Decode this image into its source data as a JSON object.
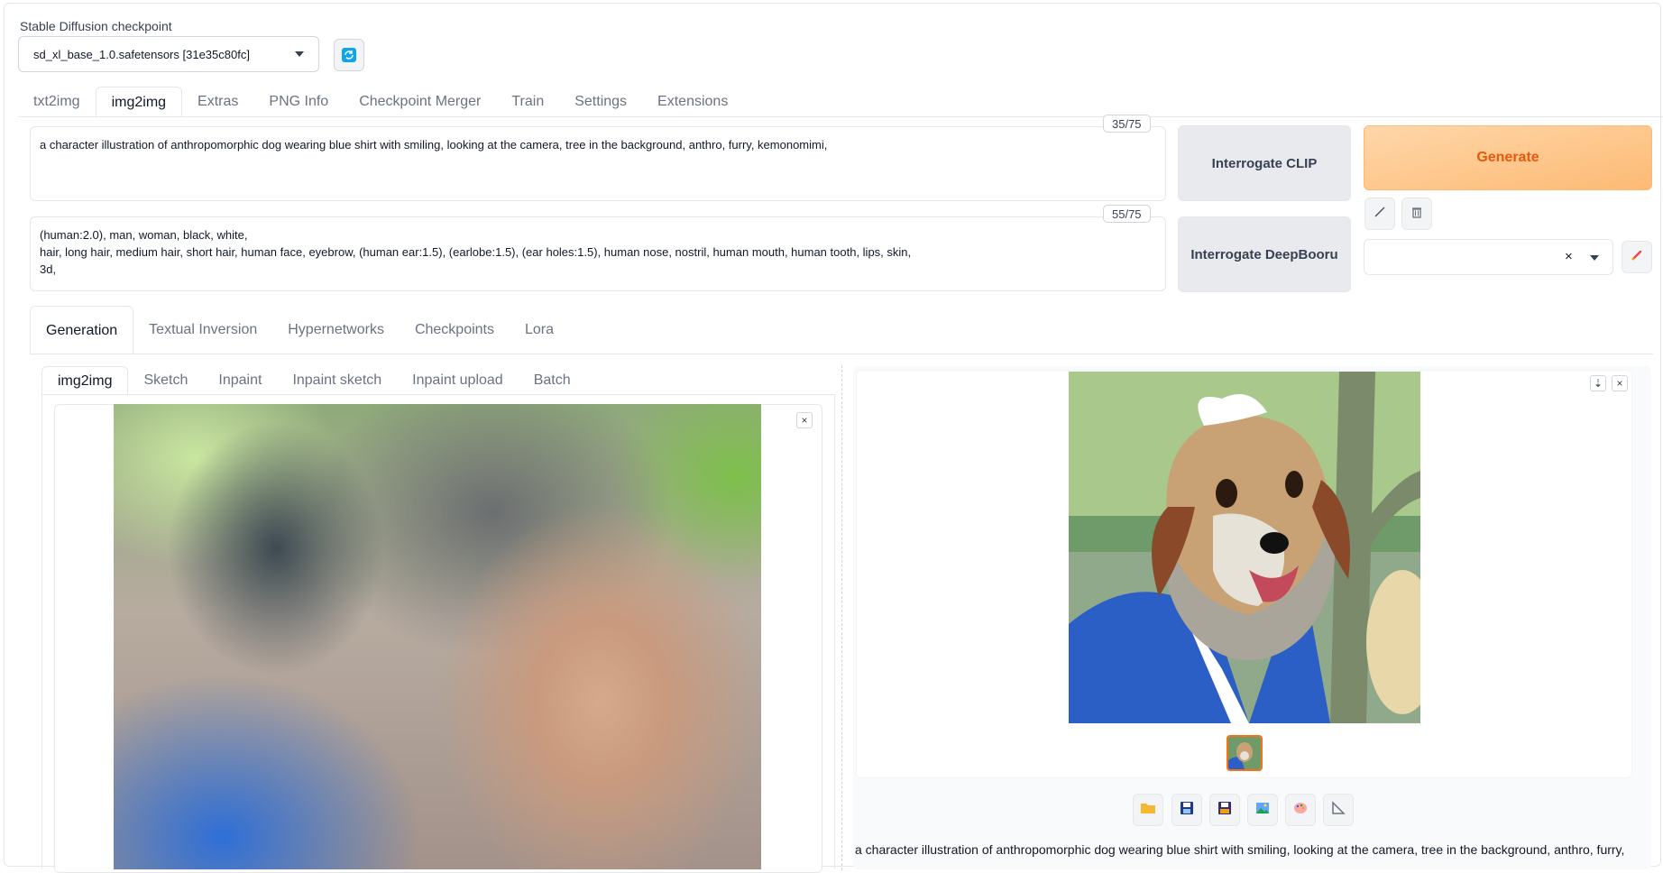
{
  "checkpoint": {
    "label": "Stable Diffusion checkpoint",
    "value": "sd_xl_base_1.0.safetensors [31e35c80fc]"
  },
  "main_tabs": [
    {
      "label": "txt2img"
    },
    {
      "label": "img2img",
      "active": true
    },
    {
      "label": "Extras"
    },
    {
      "label": "PNG Info"
    },
    {
      "label": "Checkpoint Merger"
    },
    {
      "label": "Train"
    },
    {
      "label": "Settings"
    },
    {
      "label": "Extensions"
    }
  ],
  "prompt": {
    "text": "a character illustration of anthropomorphic dog wearing blue shirt with smiling, looking at the camera, tree in the background, anthro, furry, kemonomimi,",
    "counter": "35/75"
  },
  "negative_prompt": {
    "line1": "(human:2.0), man, woman, black, white,",
    "line2": "hair, long hair, medium hair, short hair, human face, eyebrow, (human ear:1.5), (earlobe:1.5), (ear holes:1.5), human nose, nostril, human mouth, human tooth, lips, skin,",
    "line3": "3d,",
    "counter": "55/75"
  },
  "buttons": {
    "interrogate_clip": "Interrogate CLIP",
    "interrogate_deepbooru": "Interrogate DeepBooru",
    "generate": "Generate"
  },
  "style_select": {
    "clear": "×"
  },
  "generation_tabs": [
    {
      "label": "Generation",
      "active": true
    },
    {
      "label": "Textual Inversion"
    },
    {
      "label": "Hypernetworks"
    },
    {
      "label": "Checkpoints"
    },
    {
      "label": "Lora"
    }
  ],
  "image_tabs": [
    {
      "label": "img2img",
      "active": true
    },
    {
      "label": "Sketch"
    },
    {
      "label": "Inpaint"
    },
    {
      "label": "Inpaint sketch"
    },
    {
      "label": "Inpaint upload"
    },
    {
      "label": "Batch"
    }
  ],
  "close_glyph": "×",
  "download_glyph": "⇣",
  "output": {
    "caption": "a character illustration of anthropomorphic dog wearing blue shirt with smiling, looking at the camera, tree in the background, anthro, furry,"
  },
  "icons": {
    "refresh": "refresh-icon",
    "folder": "folder-icon",
    "save": "save-icon",
    "zip": "zip-icon",
    "send_img2img": "image-icon",
    "send_inpaint": "palette-icon",
    "send_extras": "ruler-icon",
    "paste": "pencil-icon",
    "trash": "trash-icon",
    "edit_styles": "paintbrush-icon"
  },
  "colors": {
    "generate_text": "#ea580c",
    "generate_bg": "#fdba74",
    "accent_blue": "#0ea5e9"
  }
}
